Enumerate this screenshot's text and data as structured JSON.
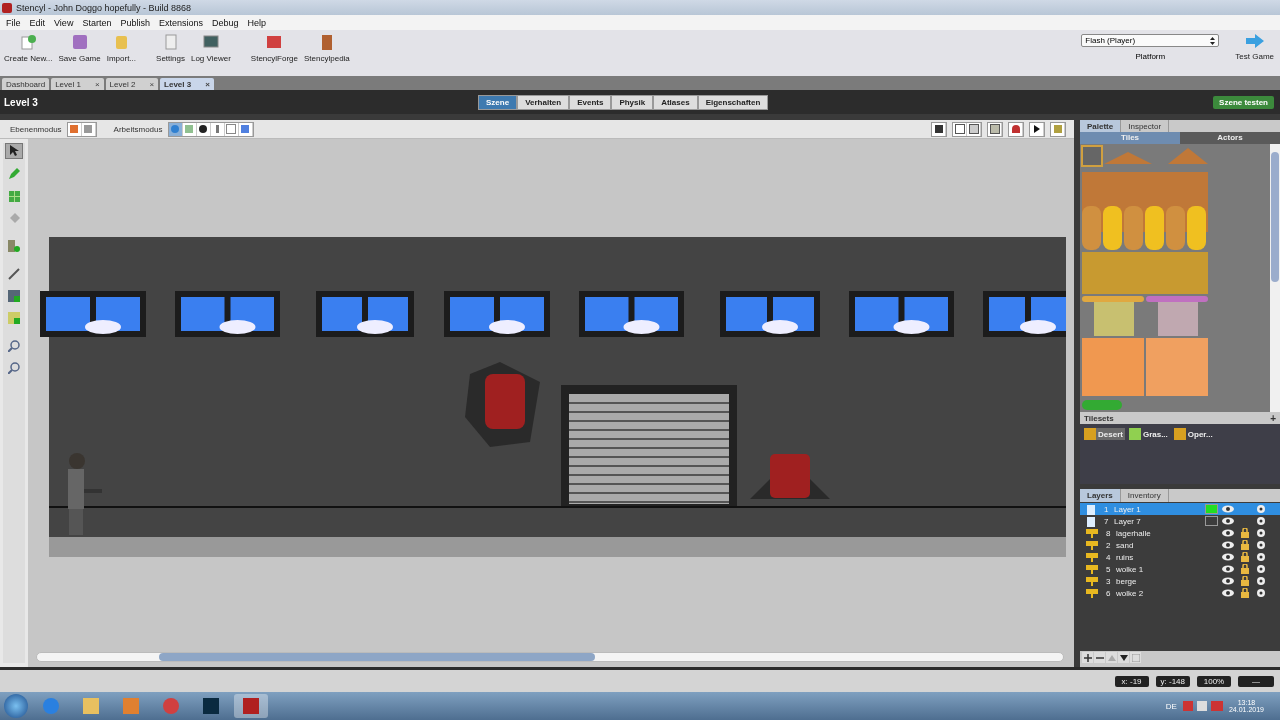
{
  "window": {
    "title": "Stencyl - John Doggo hopefully - Build 8868"
  },
  "menu": [
    "File",
    "Edit",
    "View",
    "Starten",
    "Publish",
    "Extensions",
    "Debug",
    "Help"
  ],
  "toolbar": [
    {
      "label": "Create New...",
      "kind": "new"
    },
    {
      "label": "Save Game",
      "kind": "save"
    },
    {
      "label": "Import...",
      "kind": "import"
    },
    {
      "label": "Settings",
      "kind": "settings"
    },
    {
      "label": "Log Viewer",
      "kind": "log"
    },
    {
      "label": "StencylForge",
      "kind": "forge"
    },
    {
      "label": "Stencylpedia",
      "kind": "book"
    }
  ],
  "platform": {
    "value": "Flash (Player)",
    "label": "Platform"
  },
  "test_game": "Test Game",
  "doc_tabs": [
    {
      "label": "Dashboard",
      "selected": false
    },
    {
      "label": "Level 1",
      "selected": false,
      "close": "×"
    },
    {
      "label": "Level 2",
      "selected": false,
      "close": "×"
    },
    {
      "label": "Level 3",
      "selected": true,
      "close": "×"
    }
  ],
  "scene_title": "Level 3",
  "scene_tabs": [
    {
      "label": "Szene",
      "selected": true
    },
    {
      "label": "Verhalten",
      "selected": false
    },
    {
      "label": "Events",
      "selected": false
    },
    {
      "label": "Physik",
      "selected": false
    },
    {
      "label": "Atlases",
      "selected": false
    },
    {
      "label": "Eigenschaften",
      "selected": false
    }
  ],
  "test_scene": "Szene testen",
  "mode_bar": {
    "layer_mode": "Ebenenmodus",
    "work_mode": "Arbeitsmodus"
  },
  "palette": {
    "tabs": [
      {
        "label": "Palette",
        "selected": true
      },
      {
        "label": "Inspector",
        "selected": false
      }
    ],
    "sub_tabs": [
      {
        "label": "Tiles",
        "selected": true
      },
      {
        "label": "Actors",
        "selected": false
      }
    ],
    "tilesets_title": "Tilesets",
    "tilesets_add": "+",
    "tilesets": [
      {
        "label": "Desert",
        "selected": true
      },
      {
        "label": "Gras...",
        "selected": false
      },
      {
        "label": "Oper...",
        "selected": false
      }
    ]
  },
  "layers": {
    "tabs": [
      {
        "label": "Layers",
        "selected": true
      },
      {
        "label": "Inventory",
        "selected": false
      }
    ],
    "items": [
      {
        "number": "1",
        "name": "Layer 1",
        "kind": "scene",
        "selected": true,
        "color": "#22dd22",
        "locked": false
      },
      {
        "number": "7",
        "name": "Layer 7",
        "kind": "scene",
        "selected": false,
        "locked": false
      },
      {
        "number": "8",
        "name": "lagerhalle",
        "kind": "image",
        "selected": false,
        "locked": true
      },
      {
        "number": "2",
        "name": "sand",
        "kind": "image",
        "selected": false,
        "locked": true
      },
      {
        "number": "4",
        "name": "ruins",
        "kind": "image",
        "selected": false,
        "locked": true
      },
      {
        "number": "5",
        "name": "wolke 1",
        "kind": "image",
        "selected": false,
        "locked": true
      },
      {
        "number": "3",
        "name": "berge",
        "kind": "image",
        "selected": false,
        "locked": true
      },
      {
        "number": "6",
        "name": "wolke 2",
        "kind": "image",
        "selected": false,
        "locked": true
      }
    ]
  },
  "status_bar": {
    "x": "x:  -19",
    "y": "y:  -148",
    "zoom": "100%",
    "extra": "—"
  },
  "taskbar": {
    "language": "DE",
    "time": "13:18",
    "date": "24.01.2019"
  }
}
